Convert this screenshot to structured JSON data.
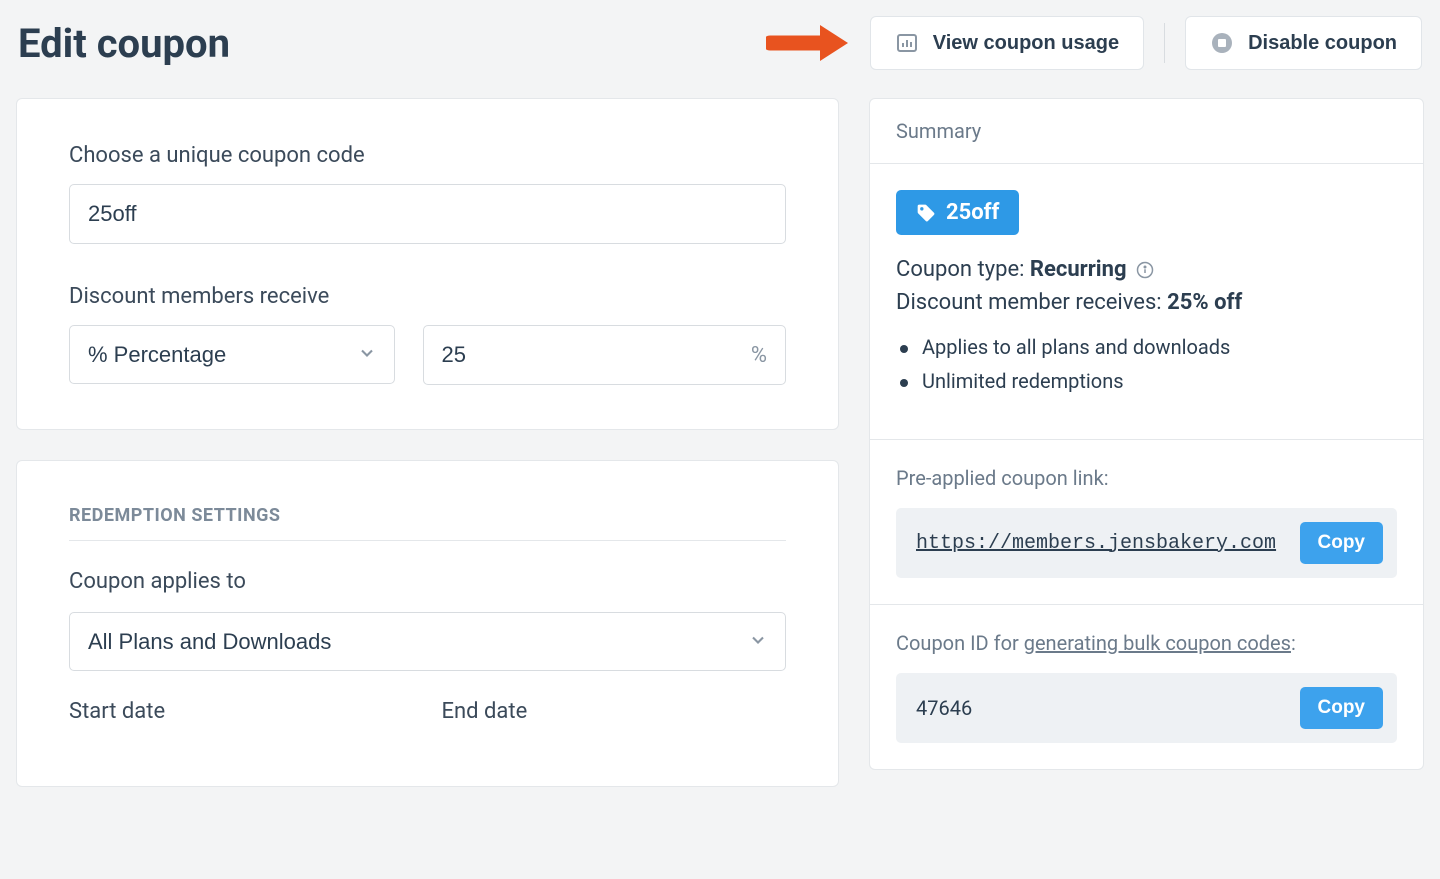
{
  "header": {
    "title": "Edit coupon",
    "view_usage": "View coupon usage",
    "disable": "Disable coupon"
  },
  "form": {
    "code_label": "Choose a unique coupon code",
    "code_value": "25off",
    "discount_label": "Discount members receive",
    "discount_type": "% Percentage",
    "discount_value": "25",
    "discount_suffix": "%"
  },
  "redemption": {
    "heading": "REDEMPTION SETTINGS",
    "applies_label": "Coupon applies to",
    "applies_value": "All Plans and Downloads",
    "start_date_label": "Start date",
    "end_date_label": "End date"
  },
  "summary": {
    "title": "Summary",
    "badge": "25off",
    "type_label": "Coupon type: ",
    "type_value": "Recurring",
    "discount_label": "Discount member receives: ",
    "discount_value": "25% off",
    "bullets": {
      "0": "Applies to all plans and downloads",
      "1": "Unlimited redemptions"
    },
    "link_label": "Pre-applied coupon link:",
    "link_value": "https://members.jensbakery.com",
    "id_label_pre": "Coupon ID for ",
    "id_label_link": "generating bulk coupon codes",
    "id_label_post": ":",
    "id_value": "47646",
    "copy": "Copy"
  }
}
